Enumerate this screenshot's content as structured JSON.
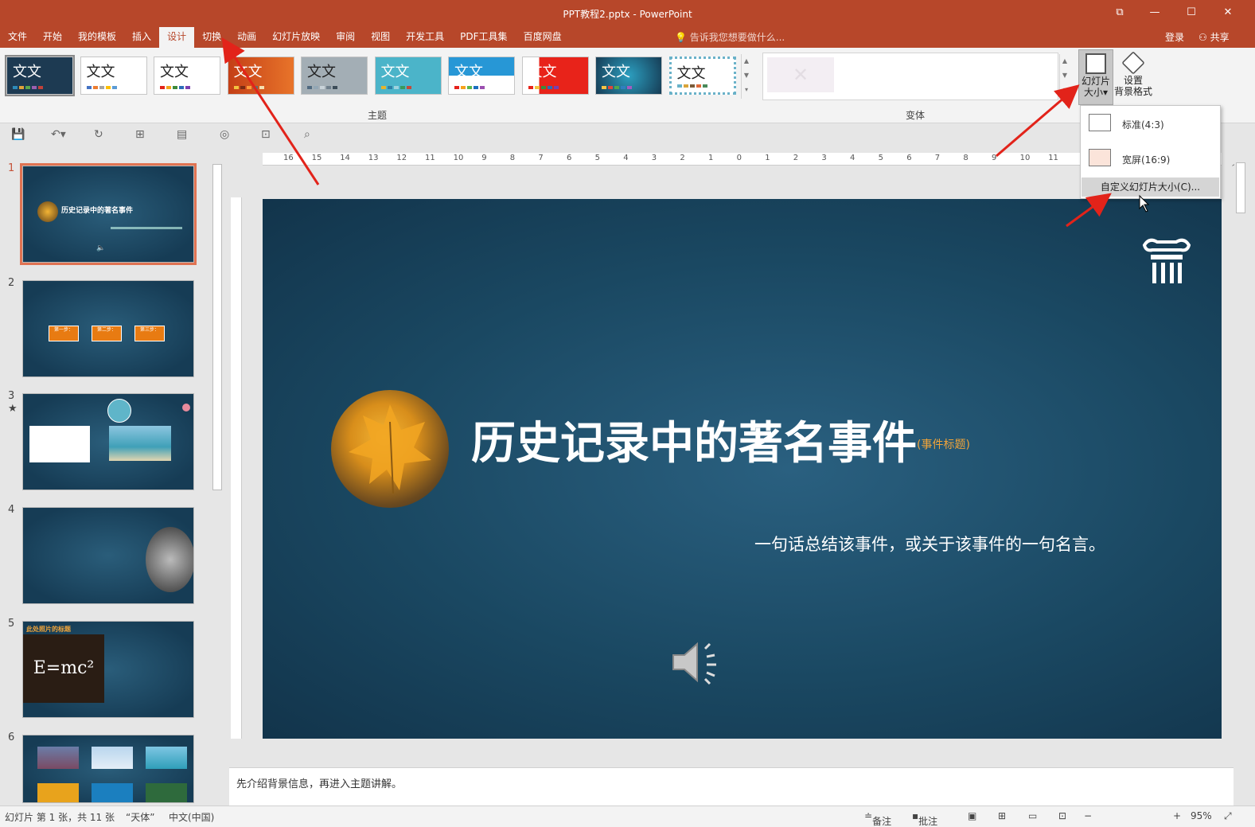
{
  "window": {
    "title": "PPT教程2.pptx - PowerPoint"
  },
  "tabs": [
    "文件",
    "开始",
    "我的模板",
    "插入",
    "设计",
    "切换",
    "动画",
    "幻灯片放映",
    "审阅",
    "视图",
    "开发工具",
    "PDF工具集",
    "百度网盘"
  ],
  "active_tab_index": 4,
  "tell_me": "告诉我您想要做什么...",
  "account": {
    "login": "登录",
    "share": "共享"
  },
  "ribbon": {
    "theme_label": "文文",
    "themes_group": "主题",
    "variants_group": "变体",
    "slide_size_button": "幻灯片\n大小",
    "slide_size_line1": "幻灯片",
    "slide_size_line2": "大小",
    "format_bg_line1": "设置",
    "format_bg_line2": "背景格式"
  },
  "dropdown": {
    "standard": "标准(4:3)",
    "widescreen": "宽屏(16:9)",
    "custom": "自定义幻灯片大小(C)..."
  },
  "thumbnails": {
    "numbers": [
      "1",
      "2",
      "3",
      "4",
      "5",
      "6"
    ],
    "slide1_title": "历史记录中的著名事件",
    "slide2_steps": [
      "第一步：",
      "第二步：",
      "第三步："
    ],
    "slide5_title": "此处照片的标题",
    "slide5_formula": "E=mc²"
  },
  "slide": {
    "title": "历史记录中的著名事件",
    "tag": "(事件标题)",
    "subtitle": "一句话总结该事件，或关于该事件的一句名言。"
  },
  "ruler_labels": [
    "16",
    "15",
    "14",
    "13",
    "12",
    "11",
    "10",
    "9",
    "8",
    "7",
    "6",
    "5",
    "4",
    "3",
    "2",
    "1",
    "0",
    "1",
    "2",
    "3",
    "4",
    "5",
    "6",
    "7",
    "8",
    "9",
    "10",
    "11"
  ],
  "notes": "先介绍背景信息，再进入主题讲解。",
  "status": {
    "slide_info": "幻灯片 第 1 张，共 11 张",
    "font": "“天体”",
    "language": "中文(中国)",
    "notes_btn": "备注",
    "comments_btn": "批注",
    "zoom": "95%"
  },
  "colors": {
    "accent": "#b7472a",
    "slide_bg": "#1a4862",
    "highlight": "#e07352"
  }
}
